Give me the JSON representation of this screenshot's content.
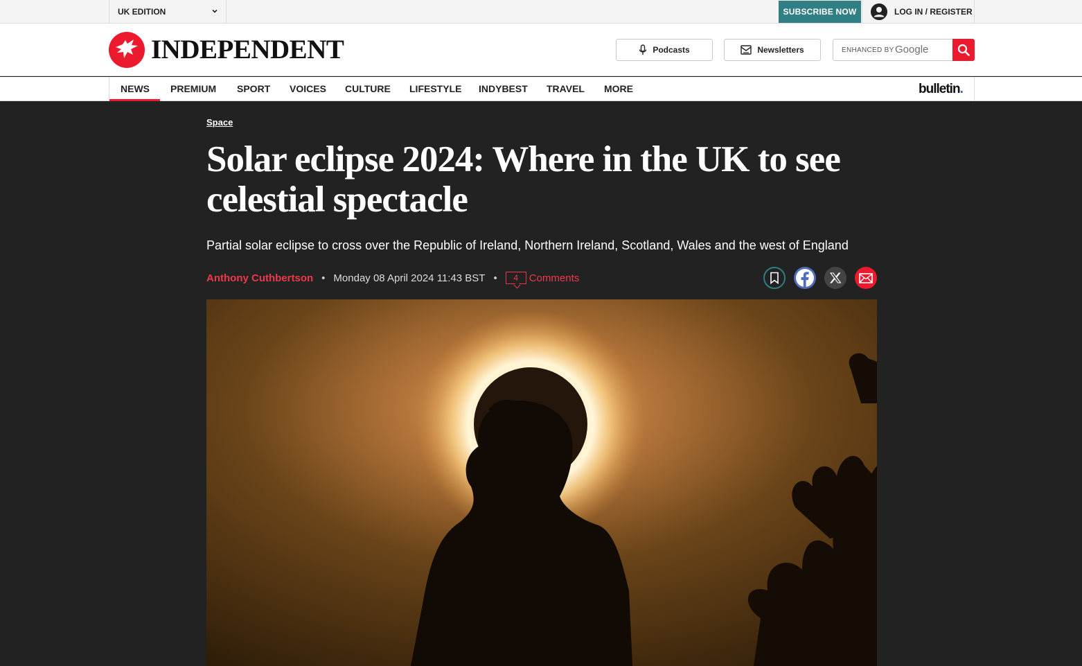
{
  "topbar": {
    "edition": "UK EDITION",
    "subscribe": "SUBSCRIBE NOW",
    "login": "LOG IN / REGISTER"
  },
  "header": {
    "brand": "INDEPENDENT",
    "podcasts": "Podcasts",
    "newsletters": "Newsletters",
    "search_placeholder": "ENHANCED BY",
    "search_brand": "Google"
  },
  "nav": {
    "items": [
      "NEWS",
      "PREMIUM",
      "SPORT",
      "VOICES",
      "CULTURE",
      "LIFESTYLE",
      "INDYBEST",
      "TRAVEL",
      "MORE"
    ],
    "active": "NEWS",
    "partner": "bulletin",
    "partner_dot": "."
  },
  "article": {
    "section": "Space",
    "headline": "Solar eclipse 2024: Where in the UK to see celestial spectacle",
    "standfirst": "Partial solar eclipse to cross over the Republic of Ireland, Northern Ireland, Scotland, Wales and the west of England",
    "author": "Anthony Cuthbertson",
    "date": "Monday 08 April 2024 11:43 BST",
    "comment_count": "4",
    "comments_label": "Comments",
    "separator": "•"
  },
  "share": {
    "icons": [
      "bookmark-icon",
      "facebook-icon",
      "x-icon",
      "email-icon"
    ]
  },
  "colors": {
    "accent": "#ec1a2e",
    "subscribe": "#2f7f84",
    "background": "#222222",
    "facebook": "#4f6db8",
    "bookmark": "#2f7f84"
  }
}
